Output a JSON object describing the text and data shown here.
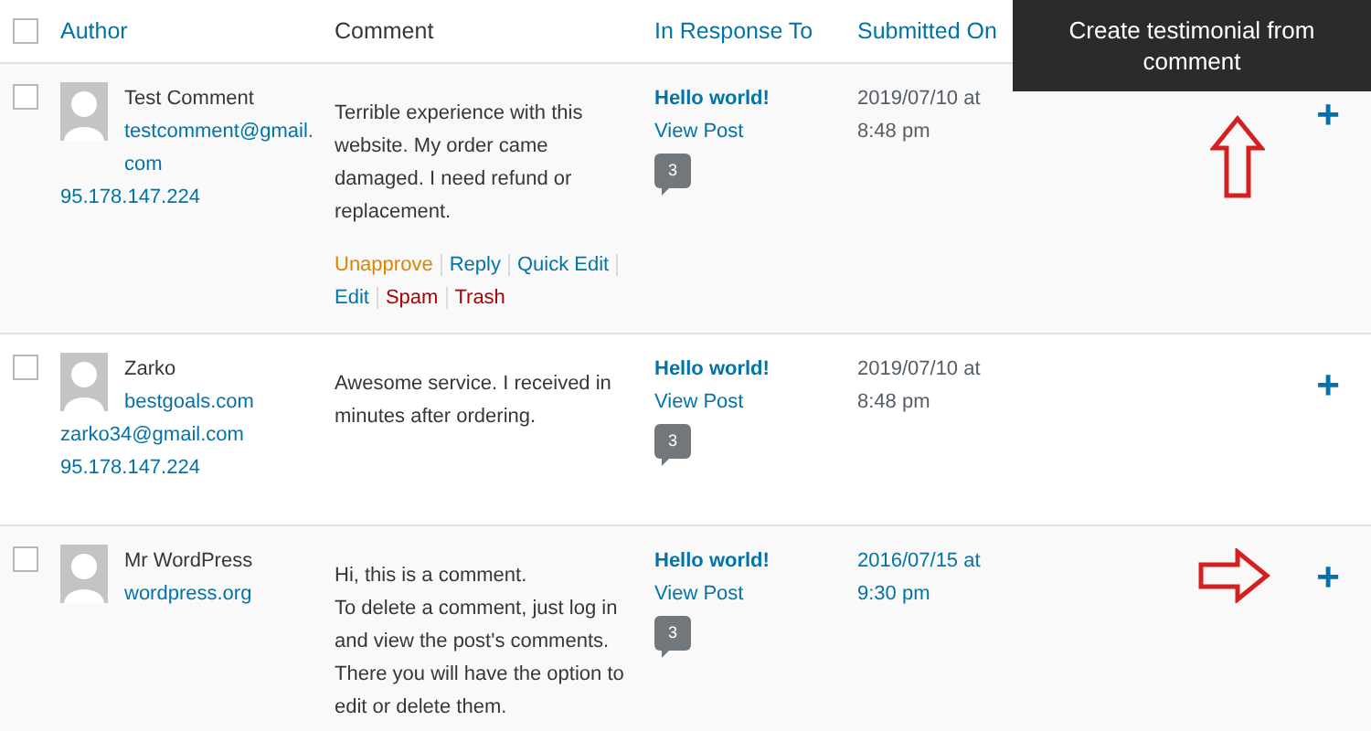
{
  "header": {
    "checked": false,
    "columns": [
      {
        "label": "Author",
        "sortable": true
      },
      {
        "label": "Comment",
        "sortable": false
      },
      {
        "label": "In Response To",
        "sortable": true
      },
      {
        "label": "Submitted On",
        "sortable": true
      }
    ]
  },
  "tooltip": {
    "text": "Create testimonial from comment"
  },
  "rows": [
    {
      "checked": false,
      "name": "Test Comment",
      "links": [
        "testcomment@gmail.com",
        "95.178.147.224"
      ],
      "paragraphs": [
        "Terrible experience with this website. My order came damaged. I need refund or replacement."
      ],
      "actions": [
        {
          "label": "Unapprove",
          "kind": "warning"
        },
        {
          "label": "Reply",
          "kind": "link"
        },
        {
          "label": "Quick Edit",
          "kind": "link"
        },
        {
          "label": "Edit",
          "kind": "link"
        },
        {
          "label": "Spam",
          "kind": "danger"
        },
        {
          "label": "Trash",
          "kind": "danger"
        }
      ],
      "post": "Hello world!",
      "view": "View Post",
      "count": "3",
      "date": [
        "2019/07/10 at",
        "8:48 pm"
      ],
      "date_is_link": false,
      "plus": "+",
      "arrow_up": true,
      "arrow_right": false
    },
    {
      "checked": false,
      "name": "Zarko",
      "links": [
        "bestgoals.com",
        "zarko34@gmail.com",
        "95.178.147.224"
      ],
      "paragraphs": [
        "Awesome service. I received in minutes after ordering."
      ],
      "post": "Hello world!",
      "view": "View Post",
      "count": "3",
      "date": [
        "2019/07/10 at",
        "8:48 pm"
      ],
      "date_is_link": false,
      "plus": "+",
      "arrow_up": false,
      "arrow_right": false
    },
    {
      "checked": false,
      "name": "Mr WordPress",
      "links": [
        "wordpress.org"
      ],
      "paragraphs": [
        "Hi, this is a comment.",
        "To delete a comment, just log in and view the post's comments. There you will have the option to edit or delete them."
      ],
      "post": "Hello world!",
      "view": "View Post",
      "count": "3",
      "date": [
        "2016/07/15 at",
        "9:30 pm"
      ],
      "date_is_link": true,
      "plus": "+",
      "arrow_up": false,
      "arrow_right": true
    }
  ]
}
